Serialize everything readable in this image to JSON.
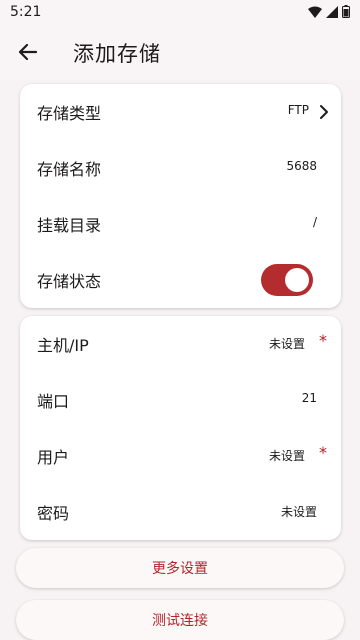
{
  "status": {
    "time": "5:21"
  },
  "header": {
    "title": "添加存储"
  },
  "card1": {
    "type": {
      "label": "存储类型",
      "value": "FTP"
    },
    "name": {
      "label": "存储名称",
      "value": "5688"
    },
    "mount": {
      "label": "挂载目录",
      "value": "/"
    },
    "state": {
      "label": "存储状态",
      "enabled": true
    }
  },
  "card2": {
    "host": {
      "label": "主机/IP",
      "value": "未设置",
      "required_mark": "*"
    },
    "port": {
      "label": "端口",
      "value": "21"
    },
    "user": {
      "label": "用户",
      "value": "未设置",
      "required_mark": "*"
    },
    "password": {
      "label": "密码",
      "value": "未设置"
    }
  },
  "actions": {
    "more": "更多设置",
    "test": "测试连接"
  },
  "colors": {
    "accent": "#b52c2e",
    "background": "#f7f2f3"
  }
}
